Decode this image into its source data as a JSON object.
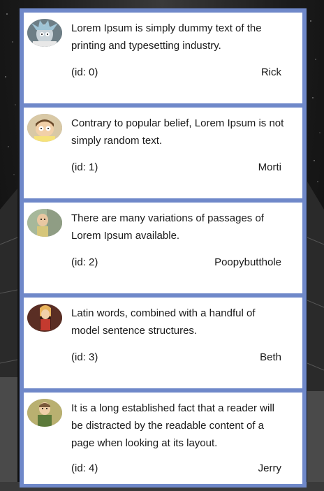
{
  "posts": [
    {
      "text": "Lorem Ipsum is simply dummy text of the printing and typesetting industry.",
      "id_label": "(id: 0)",
      "author": "Rick",
      "avatar": "rick-avatar-icon"
    },
    {
      "text": "Contrary to popular belief, Lorem Ipsum is not simply random text.",
      "id_label": "(id: 1)",
      "author": "Morti",
      "avatar": "morty-avatar-icon"
    },
    {
      "text": "There are many variations of passages of Lorem Ipsum available.",
      "id_label": "(id: 2)",
      "author": "Poopybutthole",
      "avatar": "poopybutthole-avatar-icon"
    },
    {
      "text": "Latin words, combined with a handful of model sentence structures.",
      "id_label": "(id: 3)",
      "author": "Beth",
      "avatar": "beth-avatar-icon"
    },
    {
      "text": "It is a long established fact that a reader will be distracted by the readable content of a page when looking at its layout.",
      "id_label": "(id: 4)",
      "author": "Jerry",
      "avatar": "jerry-avatar-icon"
    }
  ],
  "colors": {
    "frame": "#6f88c9",
    "card": "#ffffff",
    "text": "#1a1a1a"
  }
}
